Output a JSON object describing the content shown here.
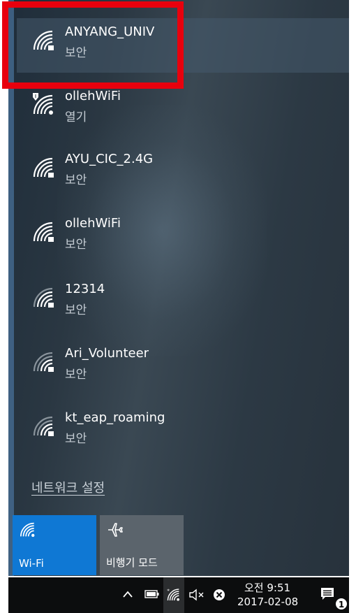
{
  "networks": [
    {
      "name": "ANYANG_UNIV",
      "status": "보안",
      "icon": "wifi-secured-icon"
    },
    {
      "name": "ollehWiFi",
      "status": "열기",
      "icon": "wifi-open-shield-icon"
    },
    {
      "name": "AYU_CIC_2.4G",
      "status": "보안",
      "icon": "wifi-secured-icon"
    },
    {
      "name": "ollehWiFi",
      "status": "보안",
      "icon": "wifi-secured-icon"
    },
    {
      "name": "12314",
      "status": "보안",
      "icon": "wifi-secured-icon"
    },
    {
      "name": "Ari_Volunteer",
      "status": "보안",
      "icon": "wifi-secured-icon"
    },
    {
      "name": "kt_eap_roaming",
      "status": "보안",
      "icon": "wifi-secured-icon"
    }
  ],
  "settings_link": "네트워크 설정",
  "tiles": {
    "wifi": {
      "label": "Wi-Fi",
      "active": true
    },
    "airplane": {
      "label": "비행기 모드",
      "active": false
    }
  },
  "taskbar": {
    "time": "오전 9:51",
    "date": "2017-02-08",
    "notification_count": "1"
  },
  "colors": {
    "accent": "#0f78d4",
    "highlight_box": "#e8000d"
  }
}
